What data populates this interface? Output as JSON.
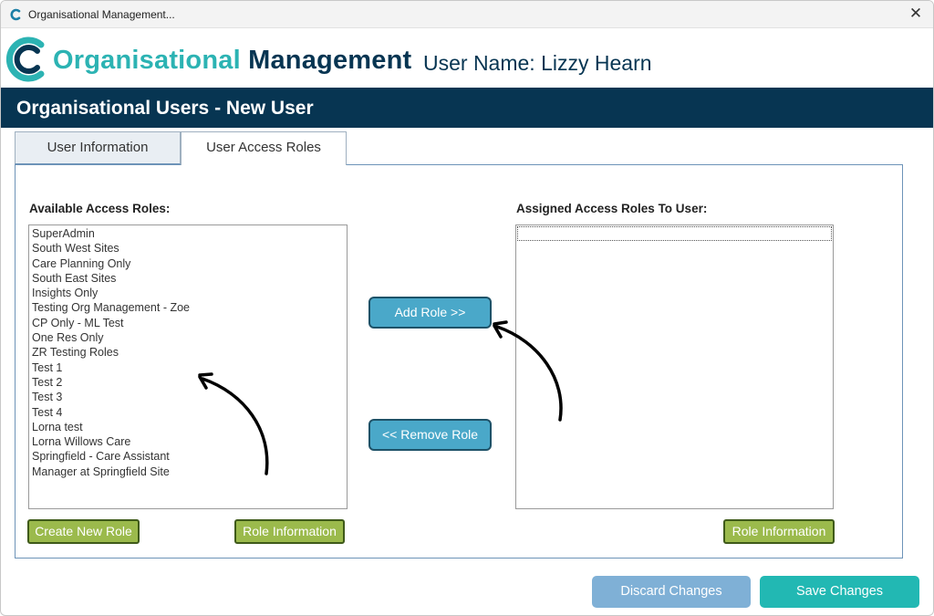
{
  "window": {
    "title": "Organisational Management..."
  },
  "header": {
    "brand_part1": "Organisational",
    "brand_part2": "Management",
    "user_label": "User Name: Lizzy Hearn"
  },
  "banner": {
    "title": "Organisational Users - New User"
  },
  "tabs": [
    {
      "label": "User Information"
    },
    {
      "label": "User Access Roles"
    }
  ],
  "available": {
    "label": "Available Access Roles:",
    "items": [
      "SuperAdmin",
      "South West Sites",
      "Care Planning Only",
      "South East Sites",
      "Insights Only",
      "Testing Org Management - Zoe",
      "CP Only - ML Test",
      "One Res Only",
      "ZR Testing Roles",
      "Test 1",
      "Test 2",
      "Test 3",
      "Test 4",
      "Lorna test",
      "Lorna Willows Care",
      "Springfield - Care Assistant",
      "Manager at Springfield Site"
    ]
  },
  "assigned": {
    "label": "Assigned Access Roles To User:"
  },
  "buttons": {
    "add_role": "Add Role >>",
    "remove_role": "<< Remove Role",
    "create_new_role": "Create New Role",
    "role_information": "Role Information",
    "discard": "Discard Changes",
    "save": "Save Changes"
  },
  "colors": {
    "navy": "#073552",
    "teal": "#2cb3b3",
    "button_blue": "#4aa8c9",
    "button_green": "#9bba4c",
    "save_teal": "#22b8b3",
    "discard_blue": "#7fb0d6"
  }
}
